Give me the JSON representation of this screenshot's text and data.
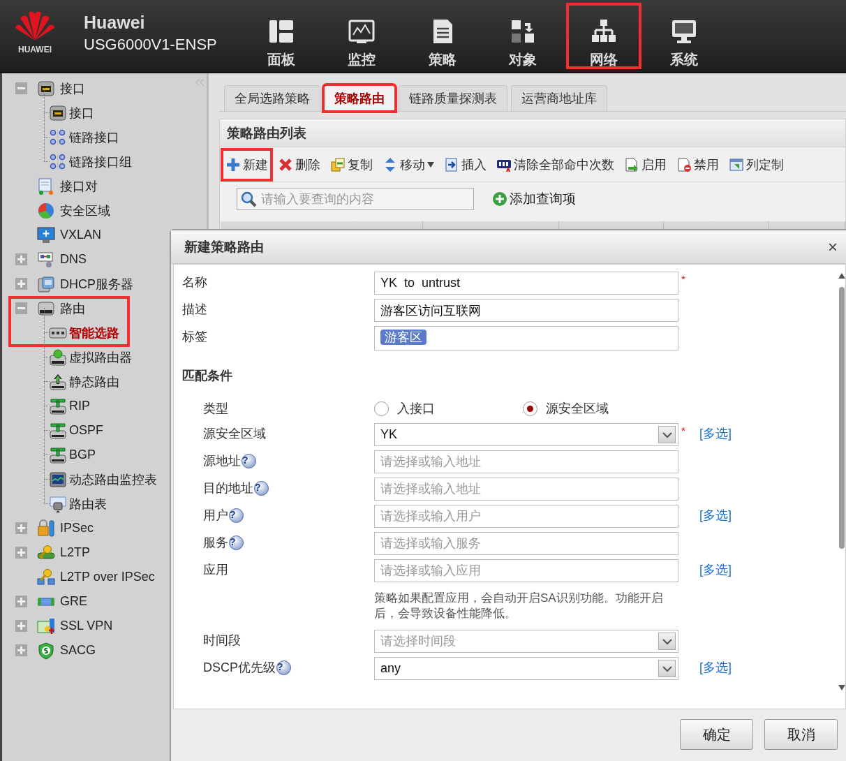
{
  "header": {
    "logo_text": "HUAWEI",
    "brand": "Huawei",
    "model": "USG6000V1-ENSP",
    "nav": [
      {
        "label": "面板",
        "highlighted": false
      },
      {
        "label": "监控",
        "highlighted": false
      },
      {
        "label": "策略",
        "highlighted": false
      },
      {
        "label": "对象",
        "highlighted": false
      },
      {
        "label": "网络",
        "highlighted": true
      },
      {
        "label": "系统",
        "highlighted": false
      }
    ]
  },
  "sidebar": {
    "tree": [
      {
        "label": "接口",
        "expanded": true,
        "selected": false,
        "children": [
          {
            "label": "接口",
            "selected": false
          },
          {
            "label": "链路接口",
            "selected": false
          },
          {
            "label": "链路接口组",
            "selected": false
          }
        ]
      },
      {
        "label": "接口对",
        "selected": false
      },
      {
        "label": "安全区域",
        "selected": false
      },
      {
        "label": "VXLAN",
        "selected": false
      },
      {
        "label": "DNS",
        "expanded": false,
        "selected": false
      },
      {
        "label": "DHCP服务器",
        "expanded": false,
        "selected": false
      },
      {
        "label": "路由",
        "expanded": true,
        "selected": false,
        "highlighted": true,
        "children": [
          {
            "label": "智能选路",
            "selected": true
          },
          {
            "label": "虚拟路由器",
            "selected": false
          },
          {
            "label": "静态路由",
            "selected": false
          },
          {
            "label": "RIP",
            "selected": false
          },
          {
            "label": "OSPF",
            "selected": false
          },
          {
            "label": "BGP",
            "selected": false
          },
          {
            "label": "动态路由监控表",
            "selected": false
          },
          {
            "label": "路由表",
            "selected": false
          }
        ]
      },
      {
        "label": "IPSec",
        "expanded": false,
        "selected": false
      },
      {
        "label": "L2TP",
        "expanded": false,
        "selected": false
      },
      {
        "label": "L2TP over IPSec",
        "selected": false
      },
      {
        "label": "GRE",
        "expanded": false,
        "selected": false
      },
      {
        "label": "SSL VPN",
        "expanded": false,
        "selected": false
      },
      {
        "label": "SACG",
        "expanded": false,
        "selected": false
      }
    ]
  },
  "main": {
    "tabs": [
      {
        "label": "全局选路策略",
        "selected": false,
        "highlighted": false
      },
      {
        "label": "策略路由",
        "selected": true,
        "highlighted": true
      },
      {
        "label": "链路质量探测表",
        "selected": false,
        "highlighted": false
      },
      {
        "label": "运营商地址库",
        "selected": false,
        "highlighted": false
      }
    ],
    "panel_title": "策略路由列表",
    "toolbar": [
      {
        "label": "新建",
        "highlighted": true
      },
      {
        "label": "删除",
        "highlighted": false
      },
      {
        "label": "复制",
        "highlighted": false
      },
      {
        "label": "移动",
        "highlighted": false,
        "dropdown": true
      },
      {
        "label": "插入",
        "highlighted": false
      },
      {
        "label": "清除全部命中次数",
        "highlighted": false
      },
      {
        "label": "启用",
        "highlighted": false
      },
      {
        "label": "禁用",
        "highlighted": false
      },
      {
        "label": "列定制",
        "highlighted": false
      }
    ],
    "search": {
      "placeholder": "请输入要查询的内容"
    },
    "add_query": "添加查询项"
  },
  "dialog": {
    "title": "新建策略路由",
    "close": "×",
    "sections": [
      {
        "rows": [
          {
            "kind": "text",
            "label": "名称",
            "value": "YK  to  untrust",
            "required": "*"
          },
          {
            "kind": "text",
            "label": "描述",
            "value": "游客区访问互联网"
          },
          {
            "kind": "tag",
            "label": "标签",
            "tags": [
              "游客区"
            ]
          }
        ]
      },
      {
        "heading": "匹配条件",
        "rows": [
          {
            "kind": "radio",
            "label": "类型",
            "options": [
              {
                "label": "入接口",
                "selected": false
              },
              {
                "label": "源安全区域",
                "selected": true
              }
            ]
          },
          {
            "kind": "select",
            "label": "源安全区域",
            "value": "YK",
            "required": "*",
            "more": "[多选]"
          },
          {
            "kind": "text",
            "label": "源地址",
            "help": "?",
            "placeholder": "请选择或输入地址"
          },
          {
            "kind": "text",
            "label": "目的地址",
            "help": "?",
            "placeholder": "请选择或输入地址"
          },
          {
            "kind": "text",
            "label": "用户",
            "help": "?",
            "placeholder": "请选择或输入用户",
            "more": "[多选]"
          },
          {
            "kind": "text",
            "label": "服务",
            "help": "?",
            "placeholder": "请选择或输入服务"
          },
          {
            "kind": "text",
            "label": "应用",
            "placeholder": "请选择或输入应用",
            "more": "[多选]"
          },
          {
            "kind": "note",
            "text": "策略如果配置应用，会自动开启SA识别功能。功能开启后，会导致设备性能降低。"
          },
          {
            "kind": "select",
            "label": "时间段",
            "placeholder": "请选择时间段"
          },
          {
            "kind": "select",
            "label": "DSCP优先级",
            "help": "?",
            "value": "any",
            "more": "[多选]"
          }
        ]
      }
    ],
    "buttons": [
      "确定",
      "取消"
    ]
  }
}
